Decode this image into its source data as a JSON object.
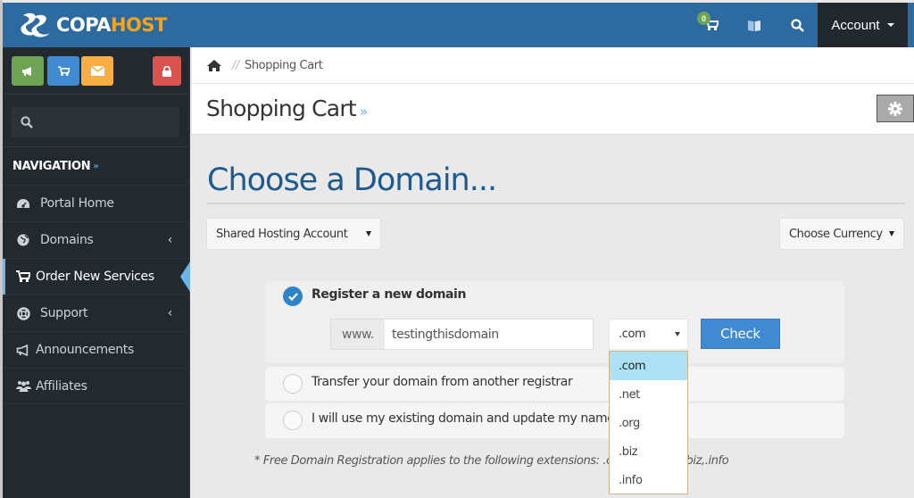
{
  "brand": {
    "name_part1": "COPA",
    "name_part2": "HOST"
  },
  "topbar": {
    "cart_count": "0",
    "icons": [
      "cart-icon",
      "language-icon",
      "search-icon"
    ],
    "account_label": "Account"
  },
  "sidebar": {
    "quick_buttons": [
      {
        "icon": "megaphone-icon",
        "color": "#6da352"
      },
      {
        "icon": "cart-icon",
        "color": "#3f8ad0"
      },
      {
        "icon": "envelope-icon",
        "color": "#f8ae43"
      },
      {
        "icon": "lock-icon",
        "color": "#d9534f"
      }
    ],
    "search_placeholder": "",
    "nav_header": "NAVIGATION",
    "items": [
      {
        "label": "Portal Home",
        "icon": "dashboard-icon",
        "has_submenu": false
      },
      {
        "label": "Domains",
        "icon": "globe-icon",
        "has_submenu": true
      },
      {
        "label": "Order New Services",
        "icon": "cart-icon",
        "has_submenu": false,
        "active": true
      },
      {
        "label": "Support",
        "icon": "lifebuoy-icon",
        "has_submenu": true
      },
      {
        "label": "Announcements",
        "icon": "megaphone-icon",
        "has_submenu": false
      },
      {
        "label": "Affiliates",
        "icon": "users-icon",
        "has_submenu": false
      }
    ]
  },
  "breadcrumb": {
    "separator": "//",
    "current": "Shopping Cart"
  },
  "page": {
    "title": "Shopping Cart",
    "title_suffix": "»"
  },
  "main": {
    "heading": "Choose a Domain...",
    "product_select": "Shared Hosting Account",
    "currency_select": "Choose Currency",
    "options": [
      {
        "label": "Register a new domain",
        "checked": true
      },
      {
        "label": "Transfer your domain from another registrar",
        "checked": false
      },
      {
        "label": "I will use my existing domain and update my nameservers",
        "checked": false
      }
    ],
    "www_prefix": "www.",
    "domain_value": "testingthisdomain",
    "tld_selected": ".com",
    "tld_options": [
      ".com",
      ".net",
      ".org",
      ".biz",
      ".info"
    ],
    "check_label": "Check",
    "note": "* Free Domain Registration applies to the following extensions: .com,.net,.org,.biz,.info"
  },
  "colors": {
    "topbar": "#2c6aa0",
    "sidebar": "#232a2f",
    "accent": "#3f8ad0",
    "heading": "#1e5a8e",
    "brand_highlight": "#f5a41a"
  }
}
